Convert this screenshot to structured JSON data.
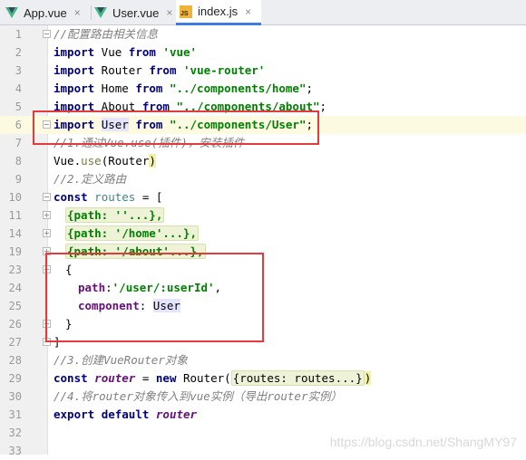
{
  "tabs": [
    {
      "label": "App.vue",
      "icon": "vue-icon",
      "active": false
    },
    {
      "label": "User.vue",
      "icon": "vue-icon",
      "active": false
    },
    {
      "label": "index.js",
      "icon": "js-file-icon",
      "active": true
    }
  ],
  "js_icon_text": "JS",
  "close_symbol": "×",
  "lines": {
    "l1": {
      "num": "1",
      "c": "//配置路由相关信息"
    },
    "l2": {
      "num": "2",
      "kw1": "import",
      "t1": " Vue ",
      "kw2": "from",
      "t2": " ",
      "s": "'vue'"
    },
    "l3": {
      "num": "3",
      "kw1": "import",
      "t1": " Router ",
      "kw2": "from",
      "t2": " ",
      "s": "'vue-router'"
    },
    "l4": {
      "num": "4",
      "kw1": "import",
      "t1": " Home ",
      "kw2": "from",
      "t2": " ",
      "s": "\"../components/home\"",
      "t3": ";"
    },
    "l5": {
      "num": "5",
      "kw1": "import",
      "t1": " About ",
      "kw2": "from",
      "t2": " ",
      "s": "\"../components/about\"",
      "t3": ";"
    },
    "l6": {
      "num": "6",
      "kw1": "import",
      "t0": " ",
      "name": "User",
      "t1": " ",
      "kw2": "from",
      "t2": " ",
      "s": "\"../components/User\"",
      "t3": ";"
    },
    "l7": {
      "num": "7",
      "c": "//1.通过Vue.use(插件)，安装插件"
    },
    "l8": {
      "num": "8",
      "a": "Vue.",
      "fn": "use",
      "b": "(Router",
      "paren": ")"
    },
    "l9": {
      "num": "9",
      "c": "//2.定义路由"
    },
    "l10": {
      "num": "10",
      "kw": "const",
      "t1": " ",
      "v": "routes",
      "t2": " = ["
    },
    "l11": {
      "num": "11",
      "f": "{path: ''...},"
    },
    "l14": {
      "num": "14",
      "f": "{path: '/home'...},"
    },
    "l19": {
      "num": "19",
      "f": "{path: '/about'...},"
    },
    "l23": {
      "num": "23",
      "t": "{"
    },
    "l24": {
      "num": "24",
      "p": "path",
      "t1": ":",
      "s": "'/user/:userId'",
      "t2": ","
    },
    "l25": {
      "num": "25",
      "p": "component",
      "t1": ": ",
      "name": "User"
    },
    "l26": {
      "num": "26",
      "t": "}"
    },
    "l27": {
      "num": "27",
      "t": "]"
    },
    "l28": {
      "num": "28",
      "c": "//3.创建VueRouter对象"
    },
    "l29": {
      "num": "29",
      "kw": "const",
      "t1": " ",
      "iv": "router",
      "t2": " = ",
      "kw2": "new",
      "t3": " Router(",
      "f": "{routes: routes...}",
      "t4": ")"
    },
    "l30": {
      "num": "30",
      "c": "//4.将router对象传入到vue实例（导出router实例）"
    },
    "l31": {
      "num": "31",
      "kw": "export",
      "t1": " ",
      "kw2": "default",
      "t2": " ",
      "iv": "router"
    },
    "l32": {
      "num": "32"
    },
    "l33": {
      "num": "33"
    }
  },
  "watermark": "https://blog.csdn.net/ShangMY97",
  "colors": {
    "annotation_box": "#e23b3b",
    "active_tab_underline": "#3e7be0",
    "current_line": "#fcfae1"
  }
}
